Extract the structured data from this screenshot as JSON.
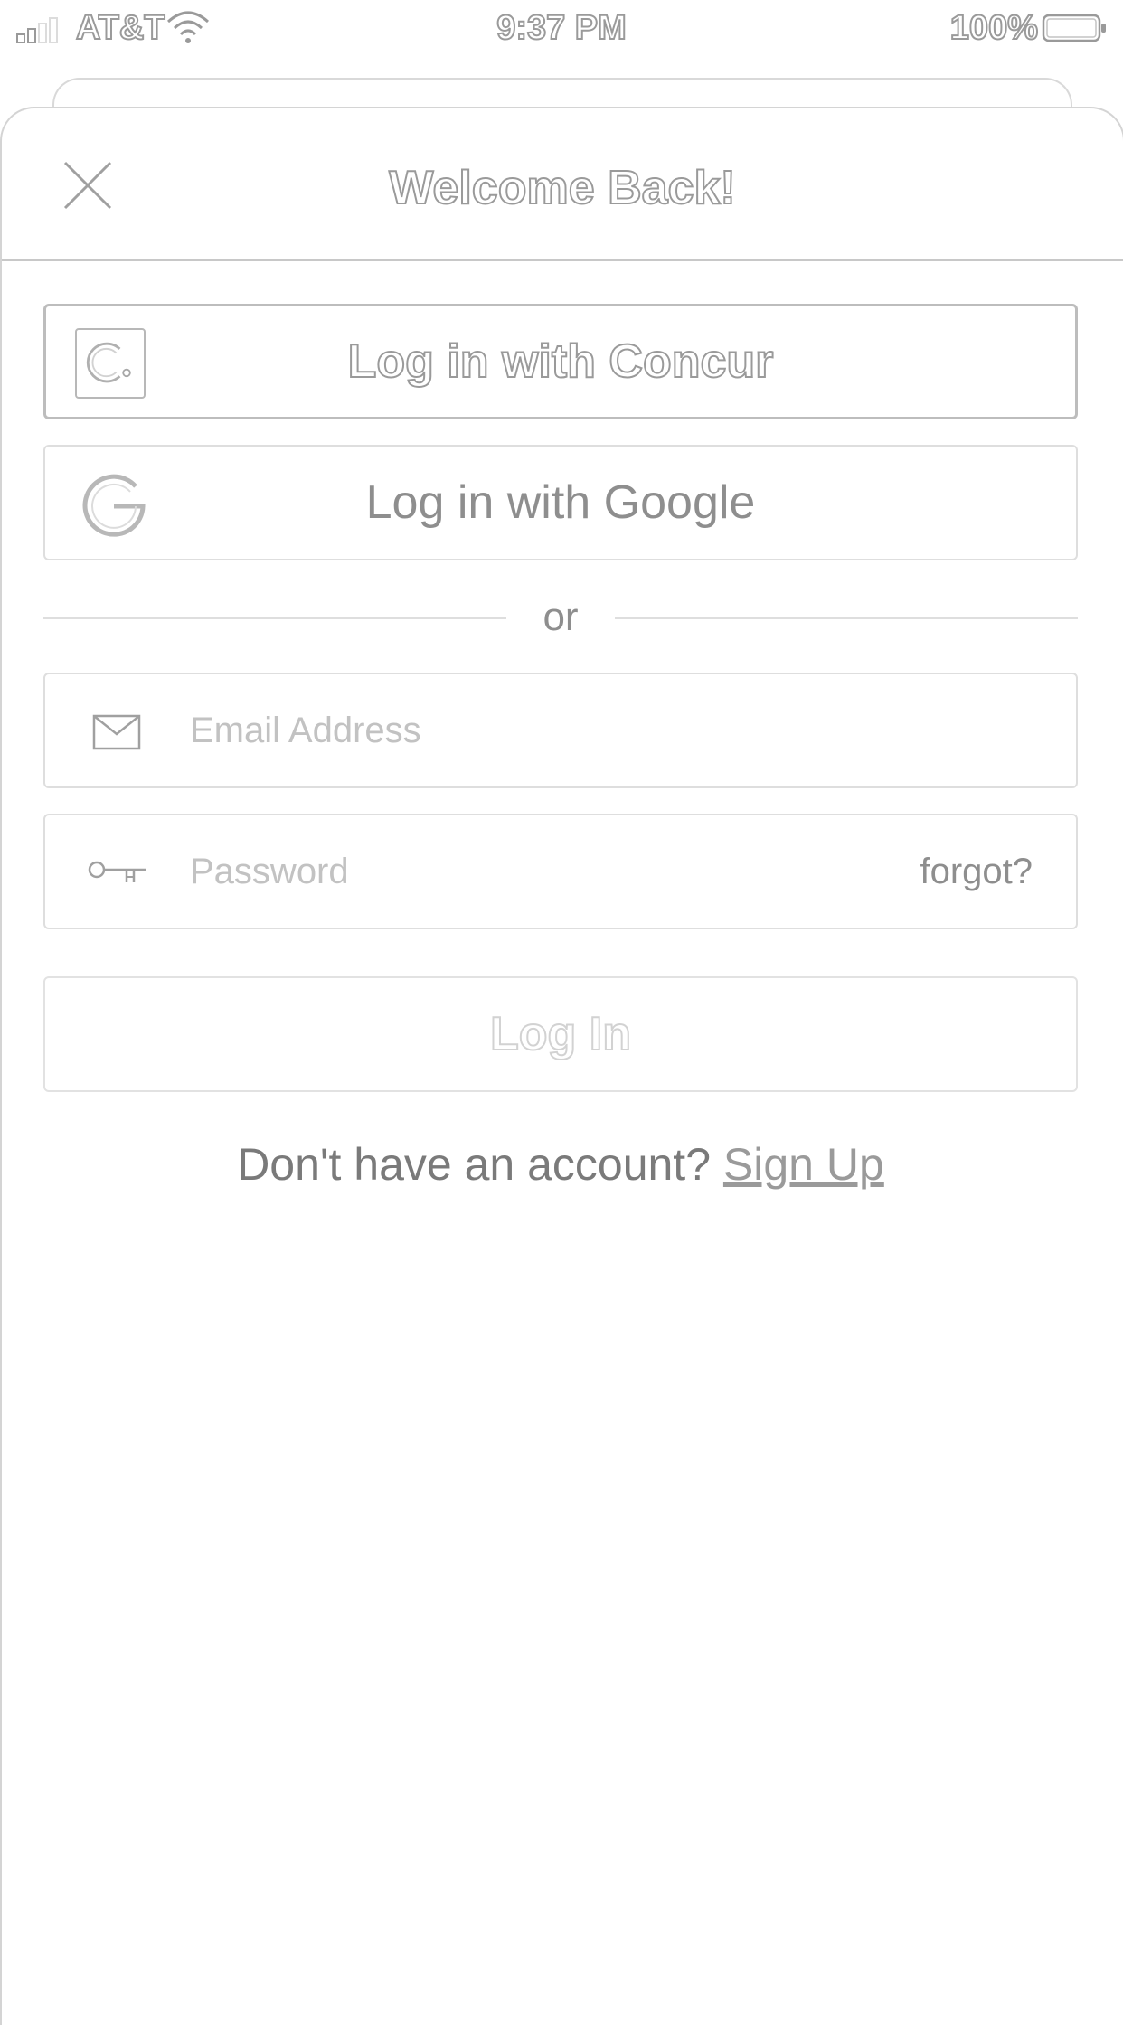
{
  "status_bar": {
    "carrier": "AT&T",
    "time": "9:37 PM",
    "battery_percent": "100%",
    "icons": [
      "signal-icon",
      "wifi-icon",
      "battery-icon"
    ]
  },
  "sheet": {
    "title": "Welcome Back!",
    "close_icon": "close-icon"
  },
  "auth": {
    "concur_label": "Log in with Concur",
    "concur_icon": "concur-logo-icon",
    "google_label": "Log in with Google",
    "google_icon": "google-logo-icon",
    "divider_text": "or",
    "email_placeholder": "Email Address",
    "email_value": "",
    "email_icon": "envelope-icon",
    "password_placeholder": "Password",
    "password_value": "",
    "password_icon": "key-icon",
    "forgot_label": "forgot?",
    "login_label": "Log In",
    "signup_prompt": "Don't have an account? ",
    "signup_link": "Sign Up"
  },
  "colors": {
    "background": "#ffffff",
    "border": "#dedede",
    "text_muted": "#8a8a8a"
  }
}
